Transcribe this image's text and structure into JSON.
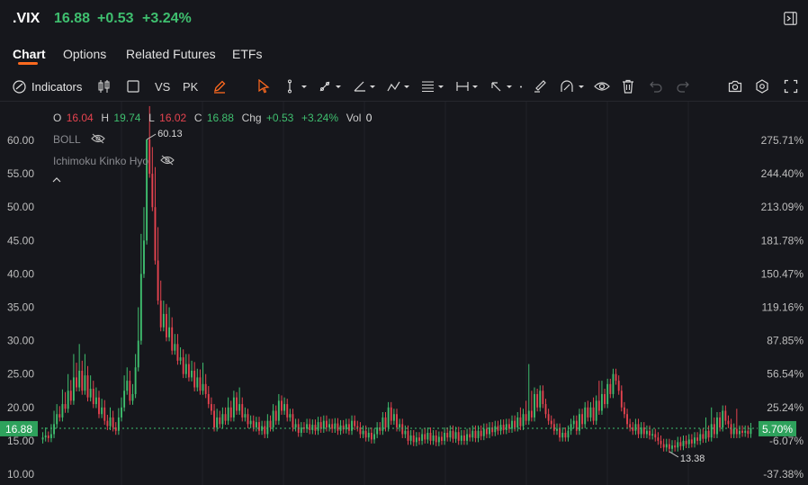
{
  "header": {
    "symbol": ".VIX",
    "price": "16.88",
    "change": "+0.53",
    "change_pct": "+3.24%"
  },
  "tabs": [
    {
      "label": "Chart",
      "active": true
    },
    {
      "label": "Options"
    },
    {
      "label": "Related Futures"
    },
    {
      "label": "ETFs"
    }
  ],
  "toolbar": {
    "indicators_label": "Indicators",
    "vs_label": "VS",
    "pk_label": "PK"
  },
  "ohlc": {
    "o_label": "O",
    "o": "16.04",
    "h_label": "H",
    "h": "19.74",
    "l_label": "L",
    "l": "16.02",
    "c_label": "C",
    "c": "16.88",
    "chg_label": "Chg",
    "chg": "+0.53",
    "chg_pct": "+3.24%",
    "vol_label": "Vol",
    "vol": "0"
  },
  "indicators": {
    "boll": "BOLL",
    "ichimoku": "Ichimoku Kinko Hyo"
  },
  "colors": {
    "up": "#3fbf6f",
    "down": "#e5434f",
    "accent": "#ff6a1f",
    "background": "#16171c"
  },
  "chart_data": {
    "type": "candlestick",
    "ylim": [
      10,
      62
    ],
    "left_ticks": [
      "60.00",
      "55.00",
      "50.00",
      "45.00",
      "40.00",
      "35.00",
      "30.00",
      "25.00",
      "20.00",
      "15.00",
      "10.00"
    ],
    "right_ticks": [
      "275.71%",
      "244.40%",
      "213.09%",
      "181.78%",
      "150.47%",
      "119.16%",
      "87.85%",
      "56.54%",
      "25.24%",
      "-6.07%",
      "-37.38%"
    ],
    "current_price_label": "16.88",
    "current_pct_label": "5.70%",
    "max_label": "60.13",
    "min_label": "13.38",
    "current_value": 16.88,
    "high_value": 60.13,
    "low_value": 13.38,
    "closes": [
      15.5,
      15.8,
      15.4,
      16.0,
      17.5,
      19.0,
      18.5,
      20.5,
      19.8,
      22.5,
      21.0,
      24.5,
      23.0,
      25.5,
      22.5,
      24.8,
      21.5,
      22.8,
      20.5,
      21.5,
      19.0,
      20.0,
      18.0,
      17.2,
      18.5,
      17.0,
      16.5,
      18.5,
      20.0,
      22.5,
      24.0,
      21.0,
      22.0,
      26.0,
      30.0,
      40.0,
      45.0,
      60.13,
      55.0,
      50.0,
      42.0,
      36.0,
      32.0,
      34.0,
      30.5,
      32.0,
      28.5,
      29.5,
      27.0,
      27.5,
      25.0,
      26.5,
      24.5,
      25.5,
      23.0,
      24.5,
      22.5,
      23.5,
      22.0,
      20.5,
      19.5,
      17.0,
      18.5,
      17.5,
      19.0,
      18.0,
      20.0,
      18.5,
      21.5,
      19.5,
      20.5,
      18.5,
      19.0,
      17.5,
      18.0,
      17.0,
      17.8,
      16.5,
      17.2,
      16.0,
      18.0,
      17.0,
      19.5,
      18.0,
      21.0,
      19.5,
      20.5,
      18.5,
      19.0,
      17.0,
      17.5,
      16.2,
      17.0,
      16.8,
      17.5,
      16.6,
      17.4,
      16.5,
      17.8,
      16.8,
      18.0,
      17.0,
      17.5,
      16.8,
      17.6,
      16.5,
      17.3,
      16.7,
      17.5,
      16.5,
      18.0,
      17.2,
      17.0,
      16.0,
      16.5,
      15.5,
      16.2,
      15.2,
      16.0,
      17.0,
      16.5,
      18.5,
      17.0,
      20.0,
      18.0,
      19.0,
      17.0,
      17.5,
      16.0,
      16.5,
      15.0,
      15.8,
      14.8,
      15.5,
      15.0,
      16.0,
      15.2,
      16.2,
      15.0,
      15.8,
      14.8,
      15.6,
      15.0,
      16.2,
      15.5,
      16.5,
      15.3,
      16.3,
      15.0,
      15.8,
      15.0,
      16.0,
      15.5,
      16.5,
      15.4,
      16.5,
      15.7,
      16.8,
      16.0,
      17.0,
      16.3,
      17.2,
      16.5,
      17.4,
      16.6,
      17.5,
      16.8,
      18.0,
      17.0,
      18.5,
      17.2,
      19.0,
      18.0,
      19.5,
      18.5,
      22.0,
      20.0,
      22.5,
      20.5,
      19.0,
      18.0,
      17.5,
      16.5,
      16.8,
      15.5,
      16.2,
      15.5,
      16.5,
      17.5,
      18.0,
      16.5,
      19.0,
      17.5,
      20.0,
      18.5,
      20.0,
      18.0,
      21.0,
      19.5,
      22.0,
      20.5,
      23.5,
      22.0,
      25.0,
      24.0,
      22.5,
      20.0,
      19.0,
      17.5,
      17.0,
      16.5,
      17.5,
      16.0,
      17.0,
      16.0,
      16.5,
      15.8,
      16.0,
      15.5,
      15.0,
      14.5,
      14.0,
      14.5,
      13.8,
      14.3,
      14.0,
      14.8,
      14.2,
      15.0,
      14.5,
      15.2,
      14.6,
      15.5,
      15.0,
      16.0,
      15.3,
      16.5,
      15.5,
      17.5,
      16.0,
      18.5,
      17.0,
      19.5,
      18.0,
      17.5,
      16.0,
      16.8,
      16.0,
      16.5,
      16.2,
      16.5,
      16.04,
      16.88
    ],
    "highs_extra": [
      0.8,
      1.2,
      0.6,
      1.5,
      2.0,
      1.5,
      1.2,
      2.2,
      1.8,
      2.5,
      1.6,
      3.5,
      2.2,
      4.0,
      1.5,
      3.2,
      1.4,
      2.0,
      1.2,
      1.5,
      1.0,
      1.3,
      1.1,
      0.9,
      1.5,
      1.0,
      0.8,
      1.4,
      1.5,
      2.3,
      2.0,
      1.5,
      1.5,
      2.0,
      5.0,
      6.0,
      5.0,
      0.0,
      5.0,
      4.0,
      6.0,
      5.0,
      3.0,
      2.0,
      1.5,
      3.0,
      1.5,
      1.5,
      1.5,
      1.5,
      1.2,
      1.5,
      1.5,
      1.5,
      1.3,
      1.3,
      1.2,
      3.2,
      1.5,
      1.2,
      1.0,
      1.0,
      1.3,
      1.0,
      1.0,
      1.0,
      1.5,
      1.0,
      1.0,
      0.8,
      2.5,
      1.0,
      1.0,
      0.8,
      0.8,
      0.8,
      0.8,
      0.8,
      0.8,
      0.8,
      1.0,
      0.8,
      1.0,
      0.8,
      1.0,
      0.8,
      1.0,
      0.8,
      0.8,
      0.8,
      0.8,
      0.8,
      0.8,
      0.8,
      0.8,
      0.8,
      0.8,
      0.8,
      0.8,
      0.8,
      0.8,
      0.8,
      0.8,
      0.8,
      0.8,
      0.8,
      0.8,
      0.8,
      0.8,
      0.8,
      0.8,
      0.8,
      0.8,
      0.8,
      0.8,
      0.8,
      0.8,
      0.8,
      0.8,
      0.8,
      0.8,
      0.8,
      0.8,
      0.8,
      0.8,
      0.8,
      0.8,
      0.8,
      0.8,
      0.8,
      0.8,
      0.8,
      0.8,
      0.8,
      0.8,
      0.8,
      0.8,
      0.8,
      0.8,
      0.8,
      0.8,
      0.8,
      0.8,
      0.8,
      0.8,
      0.8,
      0.8,
      0.8,
      0.8,
      0.8,
      0.8,
      0.8,
      0.8,
      0.8,
      0.8,
      0.8,
      0.8,
      0.8,
      0.8,
      0.8,
      0.8,
      0.8,
      0.8,
      0.8,
      0.8,
      0.8,
      0.8,
      0.8,
      0.8,
      0.8,
      1.5,
      0.8,
      2.0,
      7.0,
      3.0,
      1.0,
      0.8,
      0.8,
      0.8,
      0.8,
      0.8,
      0.8,
      0.8,
      0.8,
      0.8,
      0.8,
      0.8,
      0.8,
      0.8,
      0.8,
      0.8,
      0.8,
      0.8,
      0.8,
      1.0,
      0.8,
      1.5,
      0.8,
      3.0,
      2.0,
      0.8,
      0.8,
      0.8,
      0.8,
      0.8,
      0.8,
      0.8,
      0.8,
      0.8,
      0.8,
      0.8,
      0.8,
      0.8,
      0.8,
      0.8,
      0.8,
      0.8,
      0.8,
      0.8,
      0.8,
      0.8,
      0.8,
      0.8,
      0.8,
      0.8,
      0.8,
      0.8,
      0.8,
      0.8,
      0.8,
      0.8,
      0.8,
      0.8,
      0.8,
      0.8,
      0.8,
      2.0,
      0.8,
      2.5,
      1.0,
      0.8,
      0.8,
      0.8,
      0.8,
      0.8,
      0.8,
      0.8,
      3.0
    ]
  }
}
